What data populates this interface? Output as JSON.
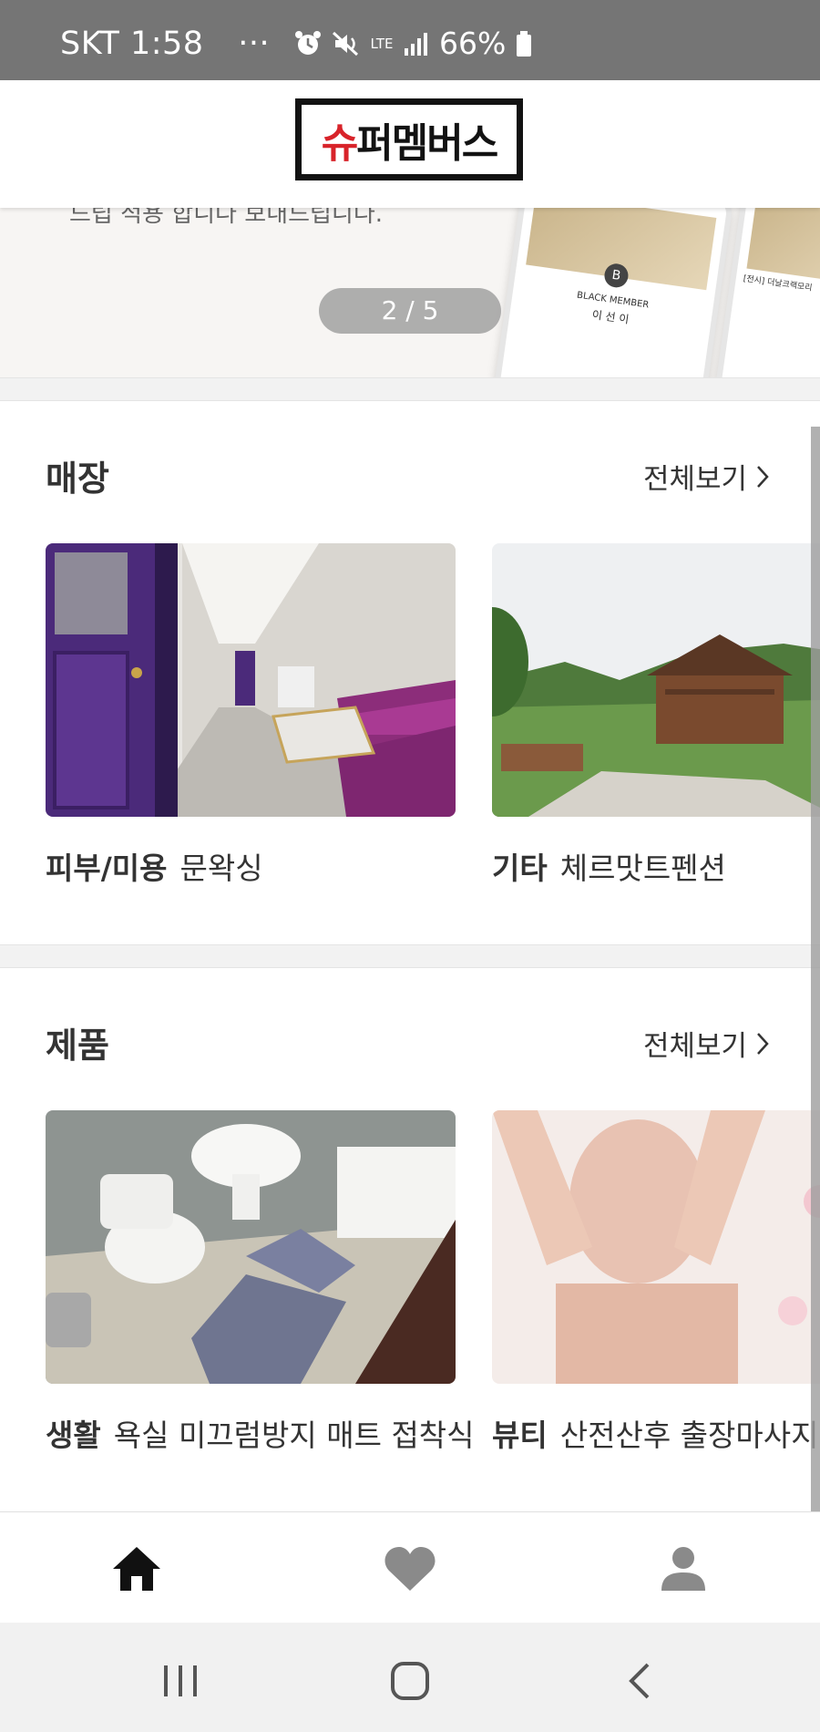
{
  "status_bar": {
    "carrier_time": "SKT 1:58",
    "more": "···",
    "network": "LTE",
    "battery": "66%"
  },
  "header": {
    "logo_prefix": "슈",
    "logo_rest": "퍼멤버스"
  },
  "banner": {
    "caption": "드립 적용 합니다 보내드립니다.",
    "phone_title": "[전시] 더날크랙모리",
    "phone_member": "BLACK MEMBER",
    "phone_name": "이 선 이",
    "page_indicator": "2 / 5"
  },
  "stores": {
    "title": "매장",
    "view_all": "전체보기",
    "items": [
      {
        "category": "피부/미용",
        "name": "문왁싱"
      },
      {
        "category": "기타",
        "name": "체르맛트펜션"
      }
    ]
  },
  "products": {
    "title": "제품",
    "view_all": "전체보기",
    "items": [
      {
        "category": "생활",
        "name": "욕실 미끄럼방지 매트 접착식"
      },
      {
        "category": "뷰티",
        "name": "산전산후 출장마사지"
      }
    ]
  },
  "bottom_nav": {
    "items": [
      "home-icon",
      "heart-icon",
      "person-icon"
    ],
    "active": "home-icon"
  },
  "system_nav": {
    "items": [
      "recents-icon",
      "home-circle-icon",
      "back-icon"
    ]
  },
  "colors": {
    "status_bar": "#757575",
    "logo_red": "#d8232a",
    "text": "#333333",
    "nav_inactive": "#8a8a8a"
  }
}
